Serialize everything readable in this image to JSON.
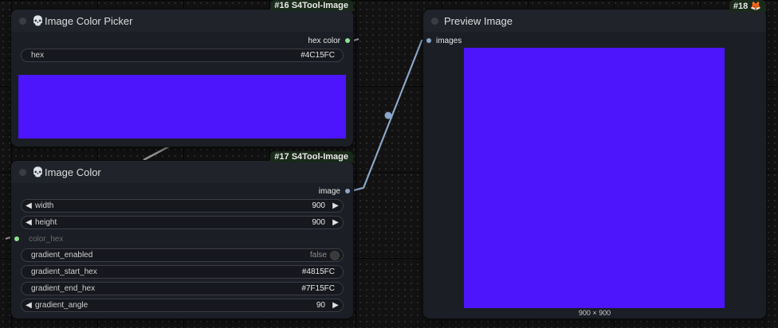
{
  "colors": {
    "picked": "#4C15FC",
    "link": "#8aa6c8",
    "link_gray": "#9a9a9a",
    "socket_green": "#8be38f"
  },
  "nodes": {
    "picker": {
      "badge": "#16 S4Tool-Image",
      "title": "Image Color Picker",
      "icon": "skull-icon",
      "output_label": "hex color",
      "hex_label": "hex",
      "hex_value": "#4C15FC"
    },
    "image_color": {
      "badge": "#17 S4Tool-Image",
      "title": "Image Color",
      "icon": "skull-icon",
      "output_label": "image",
      "width_label": "width",
      "width_value": "900",
      "height_label": "height",
      "height_value": "900",
      "color_hex_label": "color_hex",
      "gradient_enabled_label": "gradient_enabled",
      "gradient_enabled_value": "false",
      "gradient_start_label": "gradient_start_hex",
      "gradient_start_value": "#4815FC",
      "gradient_end_label": "gradient_end_hex",
      "gradient_end_value": "#7F15FC",
      "gradient_angle_label": "gradient_angle",
      "gradient_angle_value": "90"
    },
    "preview": {
      "badge": "#18 🦊",
      "title": "Preview Image",
      "input_label": "images",
      "caption": "900 × 900"
    }
  }
}
